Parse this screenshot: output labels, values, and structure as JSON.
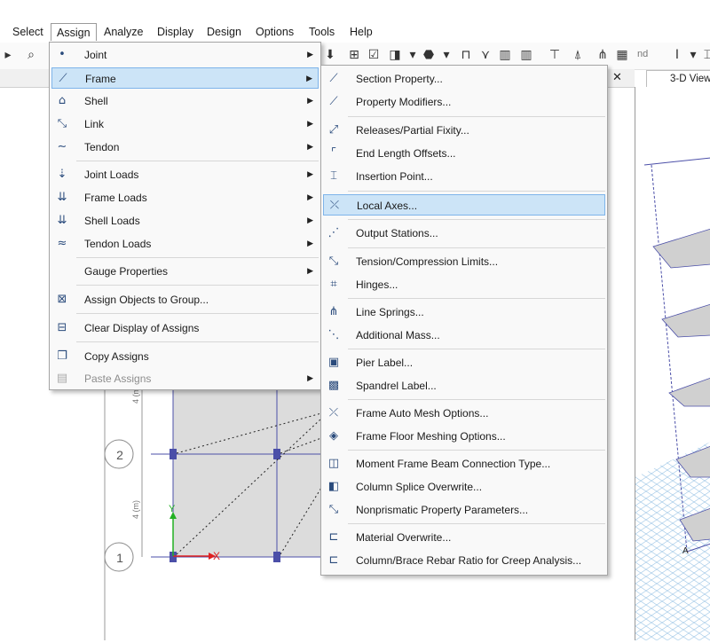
{
  "menubar": {
    "items": [
      "Select",
      "Assign",
      "Analyze",
      "Display",
      "Design",
      "Options",
      "Tools",
      "Help"
    ],
    "active": "Assign"
  },
  "toolbar": {
    "icons": [
      "play-icon",
      "zoom-icon",
      "filter-icon",
      "select-grid-icon",
      "checkbox-icon",
      "assign-shape-icon",
      "section-icon",
      "frame-icon",
      "spring-icon",
      "bars-icon",
      "pier-icon",
      "restraint-icon",
      "joint-icon",
      "text-cursor-icon",
      "dropdown-icon"
    ],
    "nd_label": "nd"
  },
  "view_tab": {
    "label": "3-D View"
  },
  "assign_menu": {
    "items": [
      {
        "label": "Joint",
        "icon": "joint-icon",
        "submenu": true,
        "enabled": true
      },
      {
        "label": "Frame",
        "icon": "frame-icon",
        "submenu": true,
        "enabled": true,
        "highlighted": true
      },
      {
        "label": "Shell",
        "icon": "shell-icon",
        "submenu": true,
        "enabled": true
      },
      {
        "label": "Link",
        "icon": "link-icon",
        "submenu": true,
        "enabled": true
      },
      {
        "label": "Tendon",
        "icon": "tendon-icon",
        "submenu": true,
        "enabled": true
      },
      {
        "label": "Joint Loads",
        "icon": "joint-loads-icon",
        "submenu": true,
        "enabled": true
      },
      {
        "label": "Frame Loads",
        "icon": "frame-loads-icon",
        "submenu": true,
        "enabled": true
      },
      {
        "label": "Shell Loads",
        "icon": "shell-loads-icon",
        "submenu": true,
        "enabled": true
      },
      {
        "label": "Tendon Loads",
        "icon": "tendon-loads-icon",
        "submenu": true,
        "enabled": true
      },
      {
        "label": "Gauge Properties",
        "icon": "",
        "submenu": true,
        "enabled": true
      },
      {
        "label": "Assign Objects to Group...",
        "icon": "group-icon",
        "submenu": false,
        "enabled": true
      },
      {
        "label": "Clear Display of Assigns",
        "icon": "clear-display-icon",
        "submenu": false,
        "enabled": true
      },
      {
        "label": "Copy Assigns",
        "icon": "copy-icon",
        "submenu": false,
        "enabled": true
      },
      {
        "label": "Paste Assigns",
        "icon": "paste-icon",
        "submenu": true,
        "enabled": false
      }
    ]
  },
  "frame_menu": {
    "items": [
      {
        "label": "Section Property...",
        "icon": "section-property-icon"
      },
      {
        "label": "Property Modifiers...",
        "icon": "property-modifiers-icon"
      },
      {
        "label": "Releases/Partial Fixity...",
        "icon": "releases-icon"
      },
      {
        "label": "End Length Offsets...",
        "icon": "end-offsets-icon"
      },
      {
        "label": "Insertion Point...",
        "icon": "insertion-point-icon"
      },
      {
        "label": "Local Axes...",
        "icon": "local-axes-icon",
        "highlighted": true
      },
      {
        "label": "Output Stations...",
        "icon": "output-stations-icon"
      },
      {
        "label": "Tension/Compression Limits...",
        "icon": "tension-compression-icon"
      },
      {
        "label": "Hinges...",
        "icon": "hinges-icon"
      },
      {
        "label": "Line Springs...",
        "icon": "line-springs-icon"
      },
      {
        "label": "Additional Mass...",
        "icon": "additional-mass-icon"
      },
      {
        "label": "Pier Label...",
        "icon": "pier-label-icon"
      },
      {
        "label": "Spandrel Label...",
        "icon": "spandrel-label-icon"
      },
      {
        "label": "Frame Auto Mesh Options...",
        "icon": "auto-mesh-icon"
      },
      {
        "label": "Frame Floor Meshing Options...",
        "icon": "floor-meshing-icon"
      },
      {
        "label": "Moment Frame Beam Connection Type...",
        "icon": "beam-connection-icon"
      },
      {
        "label": "Column Splice Overwrite...",
        "icon": "column-splice-icon"
      },
      {
        "label": "Nonprismatic Property Parameters...",
        "icon": "nonprismatic-icon"
      },
      {
        "label": "Material Overwrite...",
        "icon": "material-overwrite-icon"
      },
      {
        "label": "Column/Brace Rebar Ratio for Creep Analysis...",
        "icon": "rebar-ratio-icon"
      }
    ]
  },
  "plan": {
    "grid_bubbles": [
      "2",
      "1"
    ],
    "dimensions": [
      "4 (m)",
      "4 (m)"
    ],
    "axis_labels": {
      "x": "X",
      "y": "Y"
    }
  },
  "view3d": {
    "point_label": "A"
  },
  "colors": {
    "menu_highlight": "#cce4f7",
    "menu_highlight_border": "#7eb4ea",
    "frame_blue": "#4b4fa8",
    "axis_red": "#e02020",
    "axis_green": "#22b022"
  }
}
